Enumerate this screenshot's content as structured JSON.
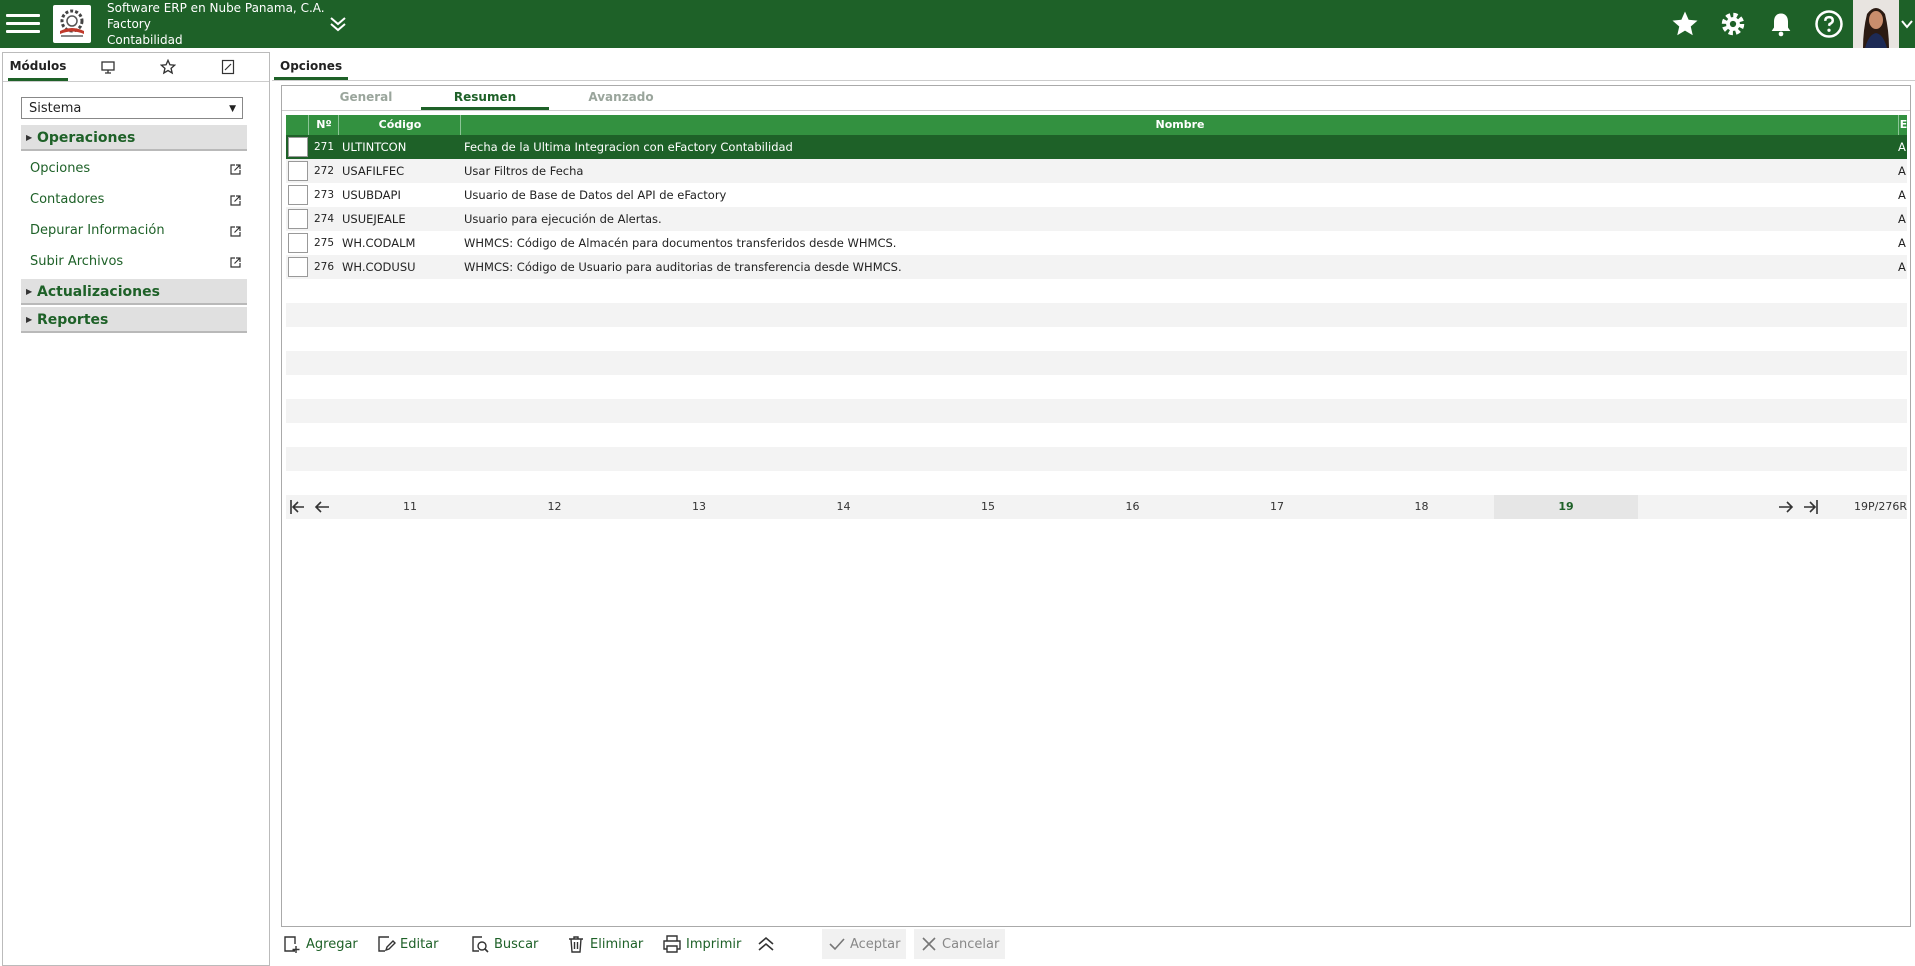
{
  "header": {
    "company": "Software ERP en Nube Panama, C.A.",
    "product": "Factory",
    "module": "Contabilidad"
  },
  "colors": {
    "brand": "#1e6128",
    "header_grid": "#339140",
    "selected_row": "#1e6128"
  },
  "left_tabs": {
    "modules": "Módulos"
  },
  "sidebar": {
    "select_value": "Sistema",
    "sections": [
      {
        "label": "Operaciones"
      },
      {
        "label": "Actualizaciones"
      },
      {
        "label": "Reportes"
      }
    ],
    "items": [
      {
        "label": "Opciones"
      },
      {
        "label": "Contadores"
      },
      {
        "label": "Depurar Información"
      },
      {
        "label": "Subir Archivos"
      }
    ]
  },
  "main": {
    "tab": "Opciones",
    "inner_tabs": [
      "General",
      "Resumen",
      "Avanzado"
    ],
    "active_inner_tab": "Resumen"
  },
  "table": {
    "columns": {
      "check": "",
      "number": "Nº",
      "code": "Código",
      "name": "Nombre",
      "e": "E"
    },
    "rows": [
      {
        "n": "271",
        "code": "ULTINTCON",
        "name": "Fecha de la Ultima Integracion con eFactory Contabilidad",
        "e": "A",
        "selected": true
      },
      {
        "n": "272",
        "code": "USAFILFEC",
        "name": "Usar Filtros de Fecha",
        "e": "A"
      },
      {
        "n": "273",
        "code": "USUBDAPI",
        "name": "Usuario de Base de Datos del API de eFactory",
        "e": "A"
      },
      {
        "n": "274",
        "code": "USUEJEALE",
        "name": "Usuario para ejecución de Alertas.",
        "e": "A"
      },
      {
        "n": "275",
        "code": "WH.CODALM",
        "name": "WHMCS: Código de Almacén para documentos transferidos desde WHMCS.",
        "e": "A"
      },
      {
        "n": "276",
        "code": "WH.CODUSU",
        "name": "WHMCS: Código de Usuario para auditorias de transferencia desde WHMCS.",
        "e": "A"
      }
    ]
  },
  "pager": {
    "pages": [
      "11",
      "12",
      "13",
      "14",
      "15",
      "16",
      "17",
      "18",
      "19"
    ],
    "current": "19",
    "info": "19P/276R"
  },
  "actions": {
    "add": "Agregar",
    "edit": "Editar",
    "search": "Buscar",
    "delete": "Eliminar",
    "print": "Imprimir",
    "accept": "Aceptar",
    "cancel": "Cancelar"
  }
}
